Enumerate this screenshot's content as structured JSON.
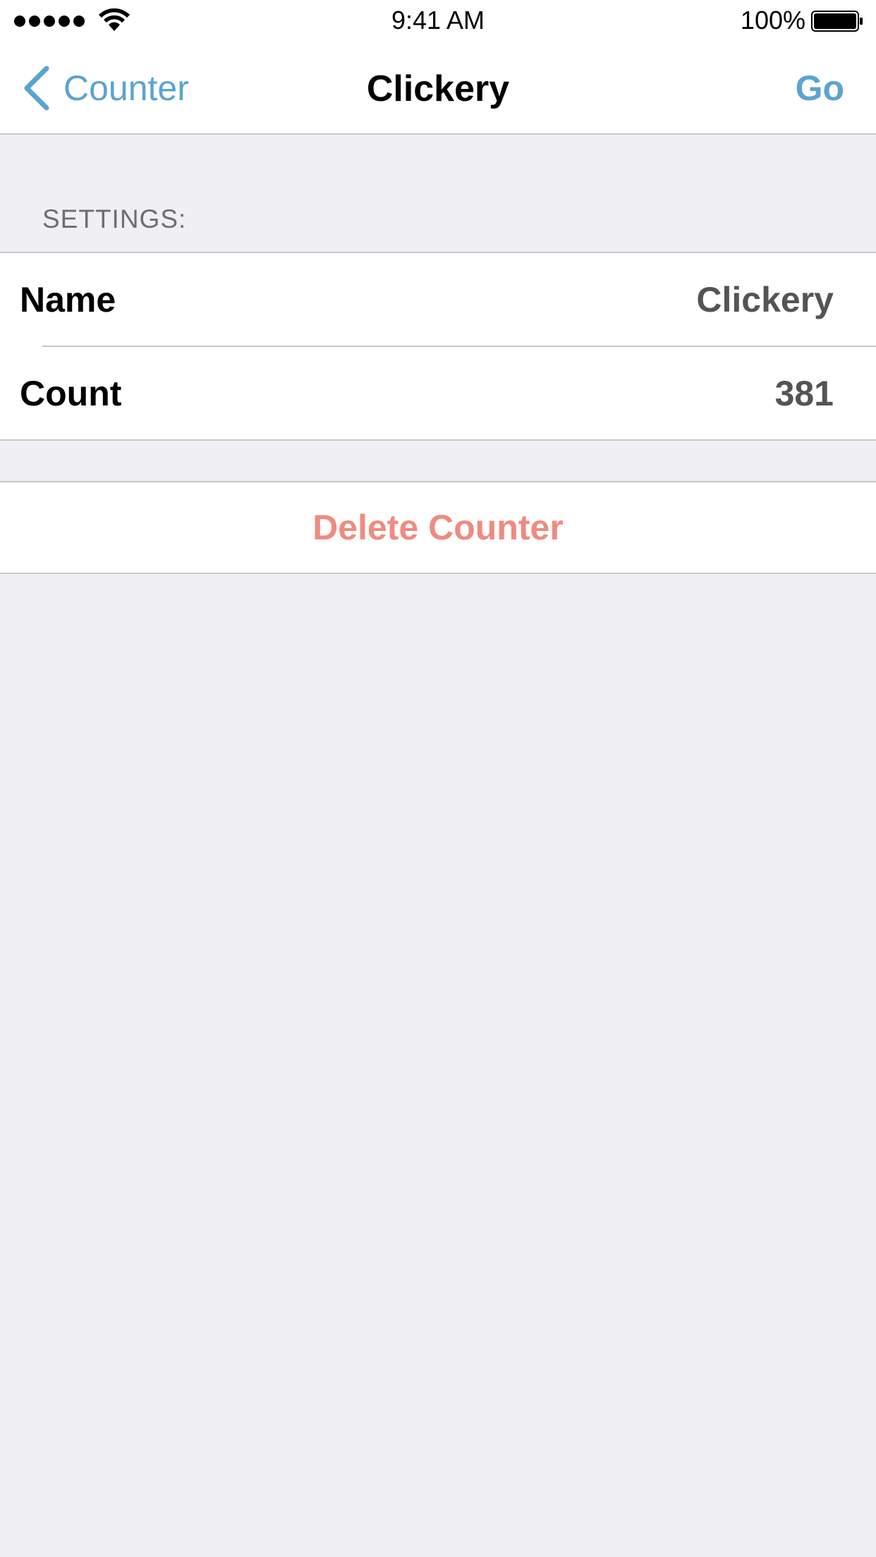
{
  "status_bar": {
    "time": "9:41 AM",
    "battery": "100%",
    "signal_icon": "signal-dots-icon",
    "wifi_icon": "wifi-icon",
    "battery_icon": "battery-full-icon"
  },
  "nav": {
    "back_label": "Counter",
    "back_icon": "chevron-left-icon",
    "title": "Clickery",
    "go_label": "Go",
    "accent_color": "#5ba4cf"
  },
  "settings": {
    "header": "SETTINGS:",
    "rows": [
      {
        "label": "Name",
        "value": "Clickery"
      },
      {
        "label": "Count",
        "value": "381"
      }
    ]
  },
  "actions": {
    "delete_label": "Delete Counter",
    "delete_color": "#ef8b80"
  },
  "colors": {
    "background": "#efeff4",
    "cell_background": "#ffffff",
    "separator": "#c8c7cc"
  }
}
